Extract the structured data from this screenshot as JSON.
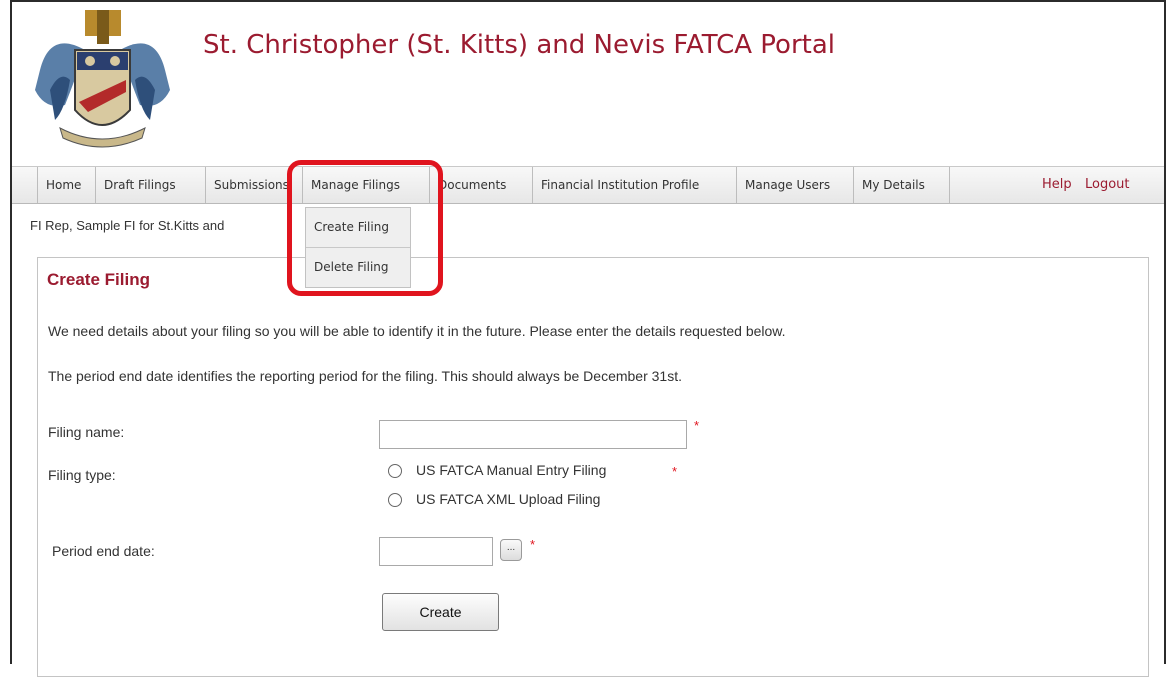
{
  "header": {
    "title": "St. Christopher (St. Kitts) and Nevis FATCA Portal",
    "crest_icon": "coat-of-arms-crest"
  },
  "nav": {
    "items": [
      "Home",
      "Draft Filings",
      "Submissions",
      "Manage Filings",
      "Documents",
      "Financial Institution Profile",
      "Manage Users",
      "My Details"
    ],
    "help": "Help",
    "logout": "Logout"
  },
  "dropdown": {
    "items": [
      "Create Filing",
      "Delete Filing"
    ]
  },
  "user_line": "FI Rep, Sample FI for St.Kitts and",
  "form": {
    "title": "Create Filing",
    "intro_1": "We need details about your filing so you will be able to identify it in the future. Please enter the details requested below.",
    "intro_2": "The period end date identifies the reporting period for the filing. This should always be December 31st.",
    "filing_name_label": "Filing name:",
    "filing_name_value": "",
    "filing_type_label": "Filing type:",
    "filing_type_options": [
      "US FATCA Manual Entry Filing",
      "US FATCA XML Upload Filing"
    ],
    "period_end_label": "Period end date:",
    "period_end_value": "",
    "calendar_button": "...",
    "required_marker": "*",
    "create_button": "Create"
  },
  "colors": {
    "brand": "#9b1b30",
    "highlight": "#e0141e",
    "navbar": "#ececec"
  }
}
